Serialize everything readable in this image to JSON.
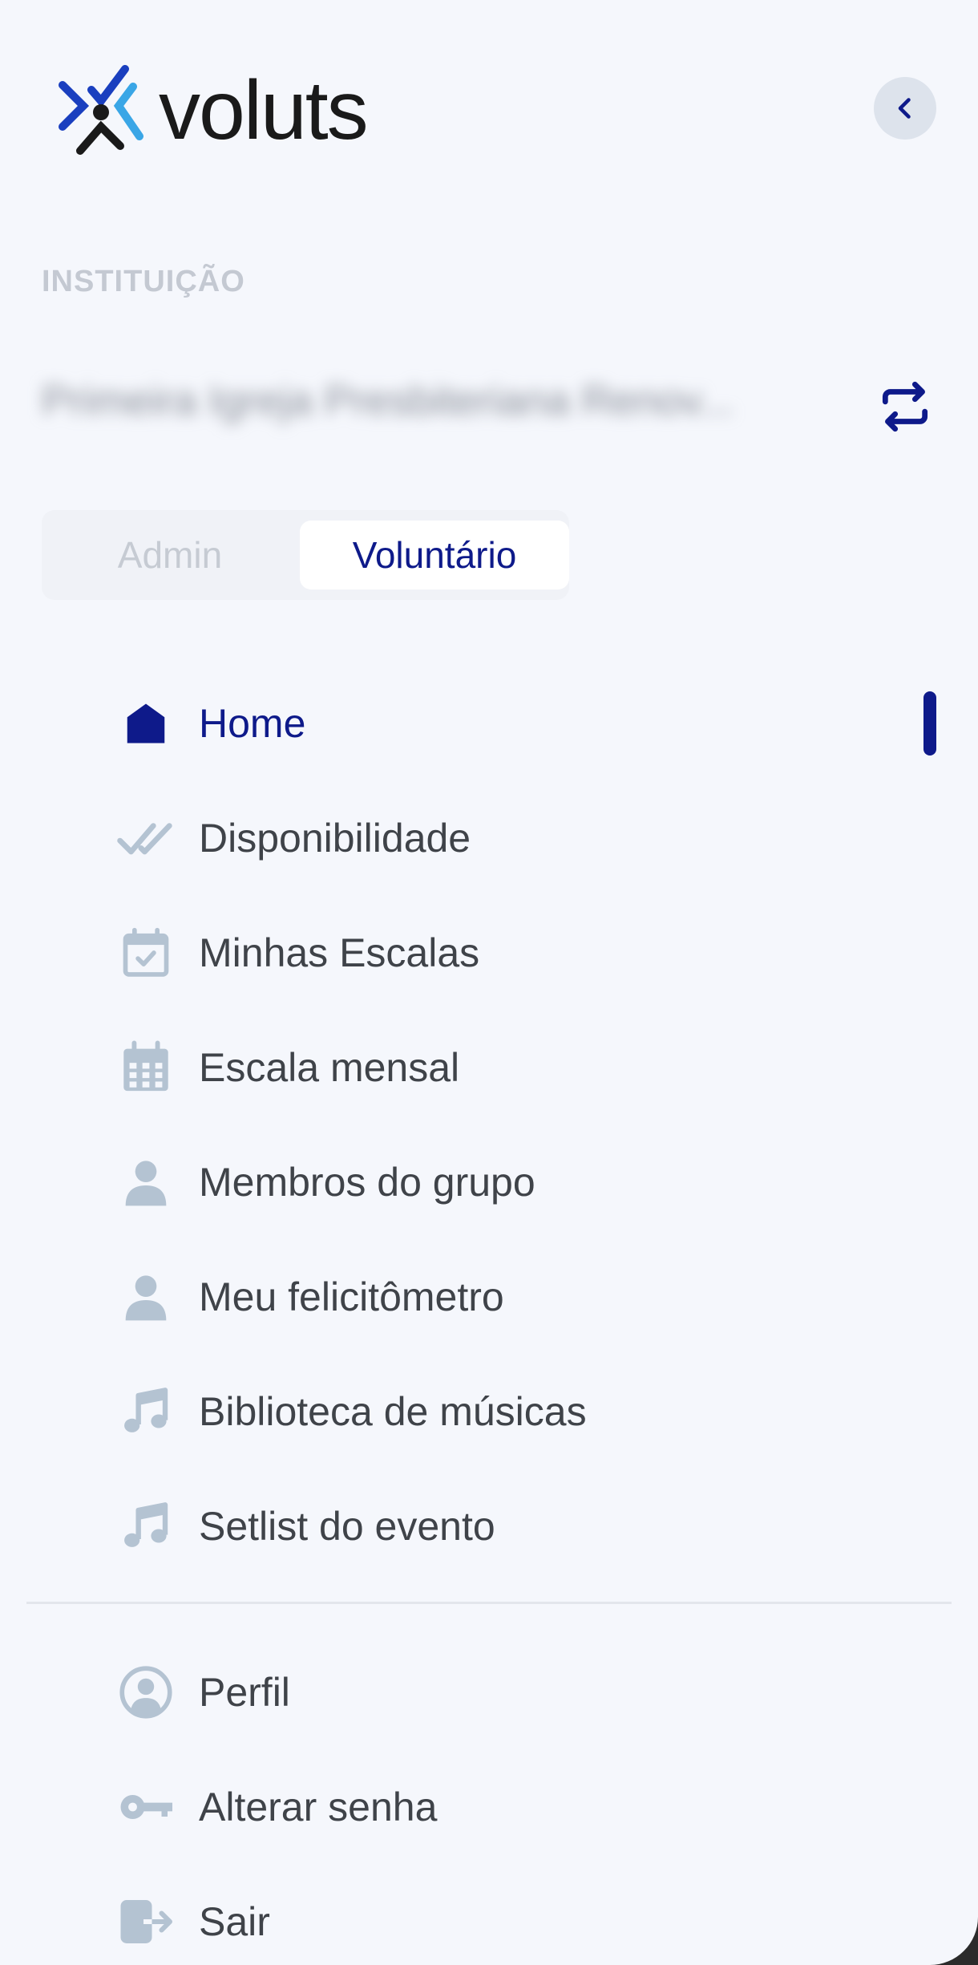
{
  "brand": {
    "name": "voluts"
  },
  "institution": {
    "section_label": "INSTITUIÇÃO",
    "name": "Primeira Igreja Presbiteriana Renov..."
  },
  "roles": {
    "admin_label": "Admin",
    "volunteer_label": "Voluntário",
    "active": "Voluntário"
  },
  "nav": {
    "items": [
      {
        "label": "Home",
        "icon": "home-icon"
      },
      {
        "label": "Disponibilidade",
        "icon": "double-check-icon"
      },
      {
        "label": "Minhas Escalas",
        "icon": "calendar-check-icon"
      },
      {
        "label": "Escala mensal",
        "icon": "calendar-grid-icon"
      },
      {
        "label": "Membros do grupo",
        "icon": "person-icon"
      },
      {
        "label": "Meu felicitômetro",
        "icon": "person-icon"
      },
      {
        "label": "Biblioteca de músicas",
        "icon": "music-note-icon"
      },
      {
        "label": "Setlist do evento",
        "icon": "music-note-icon"
      }
    ],
    "active_index": 0
  },
  "account": {
    "items": [
      {
        "label": "Perfil",
        "icon": "profile-circle-icon"
      },
      {
        "label": "Alterar senha",
        "icon": "key-icon"
      },
      {
        "label": "Sair",
        "icon": "logout-icon"
      }
    ]
  },
  "colors": {
    "accent": "#0e1a8a",
    "icon_muted": "#b4c3d2",
    "background": "#f5f7fc",
    "logo_light_blue": "#3aa6e6"
  }
}
